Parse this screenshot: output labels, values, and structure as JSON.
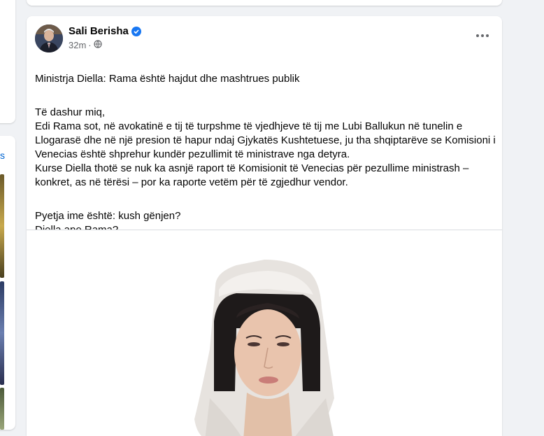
{
  "left_panel": {
    "link_text": "s"
  },
  "post": {
    "author": "Sali Berisha",
    "time": "32m",
    "visibility_icon": "globe-icon",
    "verified_icon": "verified-badge-icon",
    "more_icon": "more-options-icon",
    "title": "Ministrja Diella: Rama është hajdut dhe mashtrues publik",
    "paragraph1": "Të dashur miq,\nEdi Rama sot, në avokatinë e tij të turpshme të vjedhjeve të tij me Lubi Ballukun në tunelin e Llogarasë dhe në një presion të hapur ndaj Gjykatës Kushtetuese, ju tha shqiptarëve se Komisioni i Venecias është shprehur kundër pezullimit të ministrave nga detyra.\nKurse Diella thotë se nuk ka asnjë raport të Komisionit të Venecias për pezullime ministrash – konkret, as në tërësi – por ka raporte vetëm për të zgjedhur vendor.",
    "paragraph2": "Pyetja ime është: kush gënjen?\nDiella apo Rama?\nApo kujt t'i besojmë: Diellës që është e paanshme, apo Ramës të zhytur gjer në vesh në aferën e pistë të tunelit të Llogarasë?"
  },
  "colors": {
    "background": "#f0f2f5",
    "card": "#ffffff",
    "verified": "#1877f2",
    "secondary_text": "#65676b"
  }
}
